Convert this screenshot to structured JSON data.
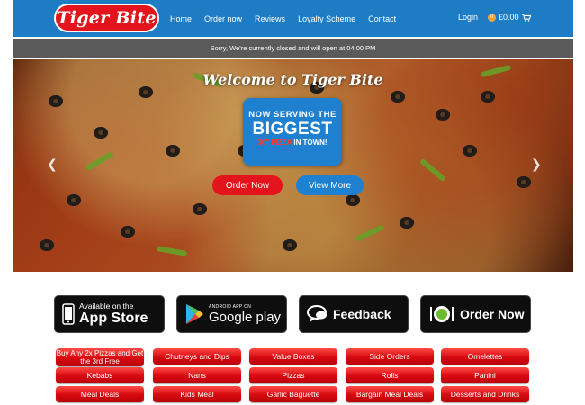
{
  "brand": {
    "name": "Tiger Bite"
  },
  "nav": {
    "links": [
      "Home",
      "Order now",
      "Reviews",
      "Loyalty Scheme",
      "Contact"
    ],
    "login": "Login",
    "cart_count": "0",
    "cart_total": "£0.00"
  },
  "notice": "Sorry, We're currently closed and will open at 04:00 PM",
  "hero": {
    "title": "Welcome to Tiger Bite",
    "badge": {
      "line1": "NOW SERVING THE",
      "line2": "BIGGEST",
      "line3_red": "30\" PIZZA",
      "line3_white": " IN TOWN!"
    },
    "order_button": "Order Now",
    "view_button": "View More",
    "prev_icon": "chevron-left-icon",
    "next_icon": "chevron-right-icon"
  },
  "store_buttons": {
    "app_store": {
      "small": "Available on the",
      "big": "App Store",
      "icon": "phone-icon"
    },
    "google_play": {
      "small": "ANDROID APP ON",
      "big": "Google play",
      "icon": "play-icon"
    },
    "feedback": {
      "label": "Feedback",
      "icon": "chat-icon"
    },
    "order_now": {
      "label": "Order Now",
      "icon": "plate-icon"
    }
  },
  "categories": {
    "row1": [
      "Buy Any 2x Pizzas and Get the 3rd Free",
      "Chutneys and Dips",
      "Value Boxes",
      "Side Orders",
      "Omelettes"
    ],
    "row2": [
      "Kebabs",
      "Nans",
      "Pizzas",
      "Rolls",
      "Panini"
    ],
    "row3": [
      "Meal Deals",
      "Kids Meal",
      "Garlic Baguette",
      "Bargain Meal Deals",
      "Desserts and Drinks"
    ]
  },
  "colors": {
    "brand_blue": "#1e7cc5",
    "brand_red": "#e3141b",
    "notice_grey": "#5a5a5a"
  }
}
